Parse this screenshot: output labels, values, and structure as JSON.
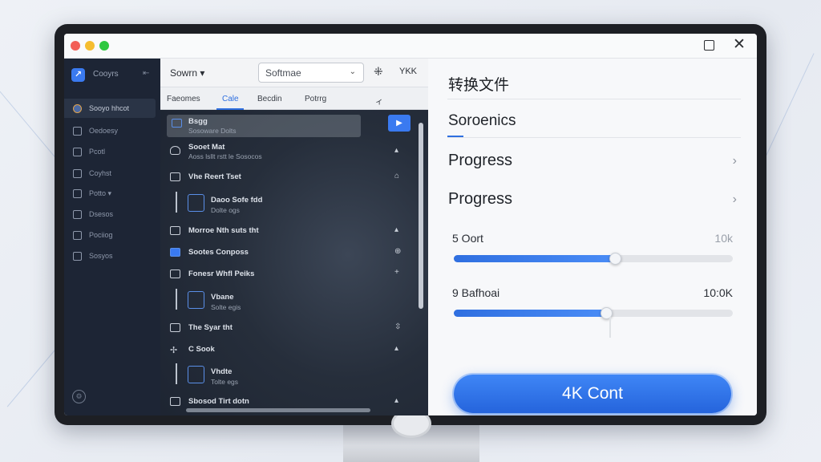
{
  "window": {
    "traffic_lights": [
      "#f25f57",
      "#f5bd2f",
      "#2ec840"
    ],
    "maximize_icon": "maximize-icon",
    "close_label": "✕"
  },
  "sidebar": {
    "app_name": "Cooyrs",
    "collapse_label": "⇤",
    "items": [
      {
        "label": "Sooyo hhcot",
        "active": true,
        "icon": "palette-icon"
      },
      {
        "label": "Oedoesy",
        "icon": "folder-icon"
      },
      {
        "label": "Pcotl",
        "icon": "document-icon"
      },
      {
        "label": "Coyhst",
        "icon": "lock-icon"
      },
      {
        "label": "Potto ▾",
        "icon": "monitor-icon"
      },
      {
        "label": "Dsesos",
        "icon": "calendar-icon"
      },
      {
        "label": "Pociiog",
        "icon": "shield-icon"
      },
      {
        "label": "Sosyos",
        "icon": "clipboard-icon"
      }
    ],
    "footer_icon": "settings-icon"
  },
  "filelist": {
    "sort_label": "Sowrn ▾",
    "select_value": "Softmae",
    "tool1": "⁜",
    "tool2": "YKK",
    "tabs": [
      "Faeomes",
      "Cale",
      "Becdin",
      "Potrrg",
      "ィ"
    ],
    "play_label": "▶",
    "rows": [
      {
        "title": "Bsgg",
        "sub": "Sosoware Dolts",
        "right": ""
      },
      {
        "title": "Sooet Mat",
        "sub": "Aoss lsllt rstt le Sosocos",
        "right": "▴"
      },
      {
        "title": "Vhe Reert Tset",
        "sub": "",
        "right": "⌂"
      },
      {
        "title": "Daoo  Sofe fdd",
        "sub": "Dolte ogs",
        "right": ""
      },
      {
        "title": "Morroe Nth suts tht",
        "sub": "",
        "right": "▴"
      },
      {
        "title": "Sootes Conposs",
        "sub": "",
        "right": "⊕"
      },
      {
        "title": "Fonesr Whfl Peiks",
        "sub": "",
        "right": "+"
      },
      {
        "title": "Vbane",
        "sub": "Solte egis",
        "right": ""
      },
      {
        "title": "The Syar tht",
        "sub": "",
        "right": "⇳"
      },
      {
        "title": "C Sook",
        "sub": "",
        "right": "▴"
      },
      {
        "title": "Vhdte",
        "sub": "Tolte egs",
        "right": ""
      },
      {
        "title": "Sbosod Tirt dotn",
        "sub": "",
        "right": "▴"
      }
    ]
  },
  "panel": {
    "title": "转换文件",
    "tab": "Soroenics",
    "rows": [
      {
        "label": "Progress",
        "arrow": "›"
      },
      {
        "label": "Progress",
        "arrow": "›"
      }
    ],
    "sliders": [
      {
        "label": "5 Oort",
        "value": "10k",
        "fraction": 0.58
      },
      {
        "label": "9 Bafhoai",
        "value": "10:0K",
        "fraction": 0.55
      }
    ],
    "button_label": "4K Cont"
  }
}
